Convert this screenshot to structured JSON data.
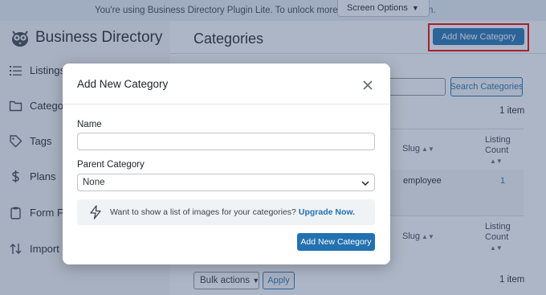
{
  "notice": {
    "text": "You're using Business Directory Plugin Lite. To unlock more features co",
    "link": "emium."
  },
  "screen_options": {
    "label": "Screen Options",
    "caret": "▼"
  },
  "sidebar": {
    "brand": "Business Directory",
    "items": [
      {
        "label": "Listings",
        "icon": "list-icon"
      },
      {
        "label": "Categor",
        "icon": "folder-icon"
      },
      {
        "label": "Tags",
        "icon": "tag-icon"
      },
      {
        "label": "Plans",
        "icon": "dollar-icon"
      },
      {
        "label": "Form Fie",
        "icon": "clipboard-icon"
      },
      {
        "label": "Import &",
        "icon": "import-export-icon"
      }
    ]
  },
  "main": {
    "title": "Categories",
    "add_new_label": "Add New Category",
    "search_button": "Search Categories",
    "item_count": "1 item",
    "columns": {
      "slug": "Slug",
      "listing_count_1": "Listing",
      "listing_count_2": "Count"
    },
    "row": {
      "slug": "employee",
      "count": "1"
    },
    "bulk_actions": "Bulk actions",
    "apply": "Apply"
  },
  "modal": {
    "title": "Add New Category",
    "name_label": "Name",
    "name_value": "",
    "parent_label": "Parent Category",
    "parent_value": "None",
    "promo_text": "Want to show a list of images for your categories?",
    "promo_link": "Upgrade Now.",
    "submit": "Add New Category"
  },
  "colors": {
    "accent": "#2271b1",
    "highlight": "#e00000",
    "overlay": "rgba(60,80,120,0.42)"
  }
}
